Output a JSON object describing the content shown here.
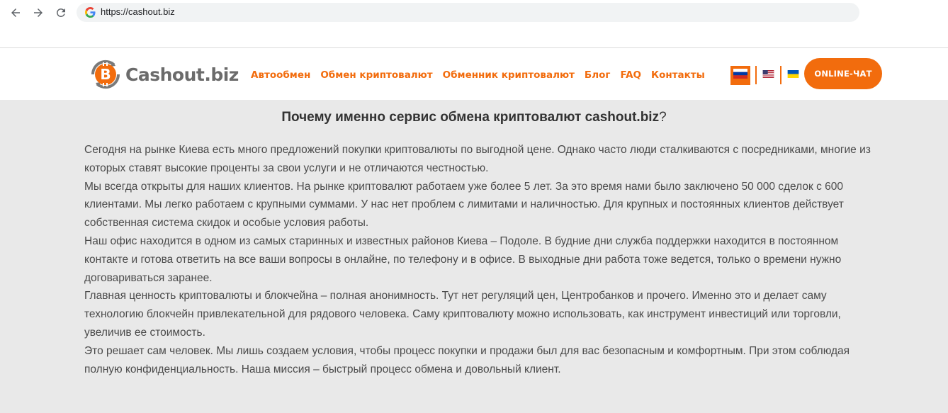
{
  "browser": {
    "url": "https://cashout.biz",
    "search_engine_icon": "google-g-icon"
  },
  "header": {
    "logo_text": "Cashout.biz",
    "logo_icon": "bitcoin-exchange-icon",
    "menu": [
      {
        "label": "Автообмен"
      },
      {
        "label": "Обмен криптовалют"
      },
      {
        "label": "Обменник криптовалют"
      },
      {
        "label": "Блог"
      },
      {
        "label": "FAQ"
      },
      {
        "label": "Контакты"
      }
    ],
    "languages": [
      {
        "code": "ru",
        "icon": "russia-flag-icon",
        "active": true
      },
      {
        "code": "en",
        "icon": "usa-flag-icon",
        "active": false
      },
      {
        "code": "ua",
        "icon": "ukraine-flag-icon",
        "active": false
      }
    ],
    "chat_button": "ONLINE-ЧАТ"
  },
  "main": {
    "heading": "Почему именно сервис обмена криптовалют cashout.biz",
    "heading_mark": "?",
    "paragraphs": [
      "Сегодня на рынке Киева есть много предложений покупки криптовалюты по выгодной цене. Однако часто люди сталкиваются с посредниками, многие из которых ставят высокие проценты за свои услуги и не отличаются честностью.",
      "Мы всегда открыты для наших клиентов. На рынке криптовалют работаем уже более 5 лет. За это время нами было заключено 50 000 сделок с 600 клиентами. Мы легко работаем с крупными суммами. У нас нет проблем с лимитами и наличностью. Для крупных и постоянных клиентов действует собственная система скидок и особые условия работы.",
      "Наш офис находится в одном из самых старинных и известных районов Киева – Подоле. В будние дни служба поддержки находится в постоянном контакте и готова ответить на все ваши вопросы в онлайне, по телефону и в офисе. В выходные дни работа тоже ведется, только о времени нужно договариваться заранее.",
      "Главная ценность криптовалюты и блокчейна – полная анонимность. Тут нет регуляций цен, Центробанков и прочего. Именно это и делает саму технологию блокчейн привлекательной для рядового человека. Саму криптовалюту можно использовать, как инструмент инвестиций или торговли, увеличив ее стоимость.",
      "Это решает сам человек. Мы лишь создаем условия, чтобы процесс покупки и продажи был для вас безопасным и комфортным. При этом соблюдая полную конфиденциальность. Наша миссия – быстрый процесс обмена и довольный клиент."
    ]
  },
  "colors": {
    "accent": "#f26c0d",
    "text": "#4a4a4a",
    "background": "#e9e9e9"
  }
}
